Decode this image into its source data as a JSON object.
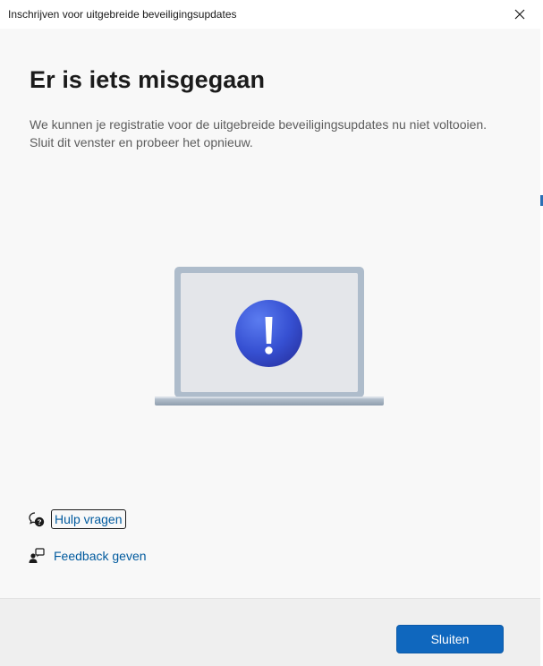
{
  "window": {
    "title": "Inschrijven voor uitgebreide beveiligingsupdates"
  },
  "main": {
    "heading": "Er is iets misgegaan",
    "description": "We kunnen je registratie voor de uitgebreide beveiligingsupdates nu niet voltooien. Sluit dit venster en probeer het opnieuw."
  },
  "links": {
    "help": "Hulp vragen",
    "feedback": "Feedback geven"
  },
  "footer": {
    "close_button": "Sluiten"
  },
  "icons": {
    "close": "close-icon",
    "illustration": "laptop-warning-icon",
    "help": "help-chat-icon",
    "feedback": "feedback-person-icon"
  },
  "colors": {
    "accent": "#0f67be",
    "link": "#005a9e",
    "warning_circle": "#3b54d4"
  }
}
